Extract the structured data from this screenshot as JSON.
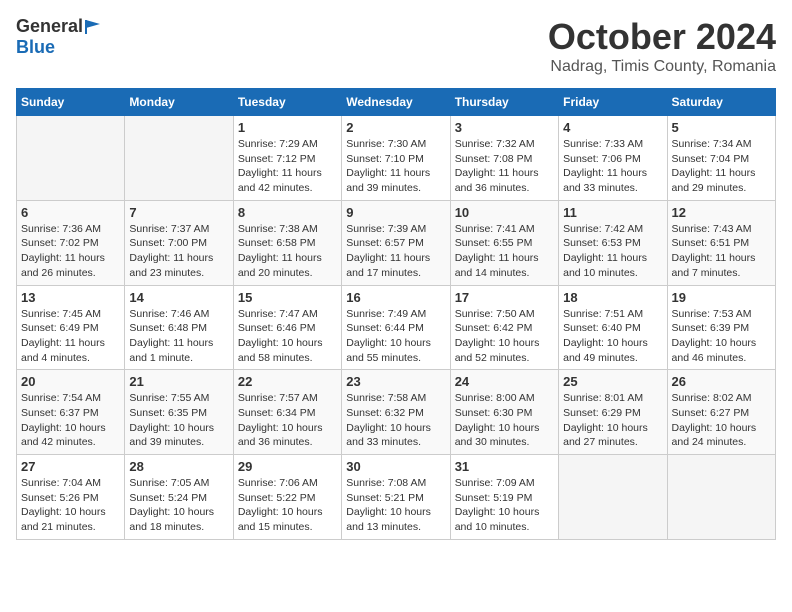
{
  "header": {
    "logo_general": "General",
    "logo_blue": "Blue",
    "month": "October 2024",
    "location": "Nadrag, Timis County, Romania"
  },
  "weekdays": [
    "Sunday",
    "Monday",
    "Tuesday",
    "Wednesday",
    "Thursday",
    "Friday",
    "Saturday"
  ],
  "weeks": [
    [
      {
        "day": "",
        "info": ""
      },
      {
        "day": "",
        "info": ""
      },
      {
        "day": "1",
        "info": "Sunrise: 7:29 AM\nSunset: 7:12 PM\nDaylight: 11 hours and 42 minutes."
      },
      {
        "day": "2",
        "info": "Sunrise: 7:30 AM\nSunset: 7:10 PM\nDaylight: 11 hours and 39 minutes."
      },
      {
        "day": "3",
        "info": "Sunrise: 7:32 AM\nSunset: 7:08 PM\nDaylight: 11 hours and 36 minutes."
      },
      {
        "day": "4",
        "info": "Sunrise: 7:33 AM\nSunset: 7:06 PM\nDaylight: 11 hours and 33 minutes."
      },
      {
        "day": "5",
        "info": "Sunrise: 7:34 AM\nSunset: 7:04 PM\nDaylight: 11 hours and 29 minutes."
      }
    ],
    [
      {
        "day": "6",
        "info": "Sunrise: 7:36 AM\nSunset: 7:02 PM\nDaylight: 11 hours and 26 minutes."
      },
      {
        "day": "7",
        "info": "Sunrise: 7:37 AM\nSunset: 7:00 PM\nDaylight: 11 hours and 23 minutes."
      },
      {
        "day": "8",
        "info": "Sunrise: 7:38 AM\nSunset: 6:58 PM\nDaylight: 11 hours and 20 minutes."
      },
      {
        "day": "9",
        "info": "Sunrise: 7:39 AM\nSunset: 6:57 PM\nDaylight: 11 hours and 17 minutes."
      },
      {
        "day": "10",
        "info": "Sunrise: 7:41 AM\nSunset: 6:55 PM\nDaylight: 11 hours and 14 minutes."
      },
      {
        "day": "11",
        "info": "Sunrise: 7:42 AM\nSunset: 6:53 PM\nDaylight: 11 hours and 10 minutes."
      },
      {
        "day": "12",
        "info": "Sunrise: 7:43 AM\nSunset: 6:51 PM\nDaylight: 11 hours and 7 minutes."
      }
    ],
    [
      {
        "day": "13",
        "info": "Sunrise: 7:45 AM\nSunset: 6:49 PM\nDaylight: 11 hours and 4 minutes."
      },
      {
        "day": "14",
        "info": "Sunrise: 7:46 AM\nSunset: 6:48 PM\nDaylight: 11 hours and 1 minute."
      },
      {
        "day": "15",
        "info": "Sunrise: 7:47 AM\nSunset: 6:46 PM\nDaylight: 10 hours and 58 minutes."
      },
      {
        "day": "16",
        "info": "Sunrise: 7:49 AM\nSunset: 6:44 PM\nDaylight: 10 hours and 55 minutes."
      },
      {
        "day": "17",
        "info": "Sunrise: 7:50 AM\nSunset: 6:42 PM\nDaylight: 10 hours and 52 minutes."
      },
      {
        "day": "18",
        "info": "Sunrise: 7:51 AM\nSunset: 6:40 PM\nDaylight: 10 hours and 49 minutes."
      },
      {
        "day": "19",
        "info": "Sunrise: 7:53 AM\nSunset: 6:39 PM\nDaylight: 10 hours and 46 minutes."
      }
    ],
    [
      {
        "day": "20",
        "info": "Sunrise: 7:54 AM\nSunset: 6:37 PM\nDaylight: 10 hours and 42 minutes."
      },
      {
        "day": "21",
        "info": "Sunrise: 7:55 AM\nSunset: 6:35 PM\nDaylight: 10 hours and 39 minutes."
      },
      {
        "day": "22",
        "info": "Sunrise: 7:57 AM\nSunset: 6:34 PM\nDaylight: 10 hours and 36 minutes."
      },
      {
        "day": "23",
        "info": "Sunrise: 7:58 AM\nSunset: 6:32 PM\nDaylight: 10 hours and 33 minutes."
      },
      {
        "day": "24",
        "info": "Sunrise: 8:00 AM\nSunset: 6:30 PM\nDaylight: 10 hours and 30 minutes."
      },
      {
        "day": "25",
        "info": "Sunrise: 8:01 AM\nSunset: 6:29 PM\nDaylight: 10 hours and 27 minutes."
      },
      {
        "day": "26",
        "info": "Sunrise: 8:02 AM\nSunset: 6:27 PM\nDaylight: 10 hours and 24 minutes."
      }
    ],
    [
      {
        "day": "27",
        "info": "Sunrise: 7:04 AM\nSunset: 5:26 PM\nDaylight: 10 hours and 21 minutes."
      },
      {
        "day": "28",
        "info": "Sunrise: 7:05 AM\nSunset: 5:24 PM\nDaylight: 10 hours and 18 minutes."
      },
      {
        "day": "29",
        "info": "Sunrise: 7:06 AM\nSunset: 5:22 PM\nDaylight: 10 hours and 15 minutes."
      },
      {
        "day": "30",
        "info": "Sunrise: 7:08 AM\nSunset: 5:21 PM\nDaylight: 10 hours and 13 minutes."
      },
      {
        "day": "31",
        "info": "Sunrise: 7:09 AM\nSunset: 5:19 PM\nDaylight: 10 hours and 10 minutes."
      },
      {
        "day": "",
        "info": ""
      },
      {
        "day": "",
        "info": ""
      }
    ]
  ]
}
